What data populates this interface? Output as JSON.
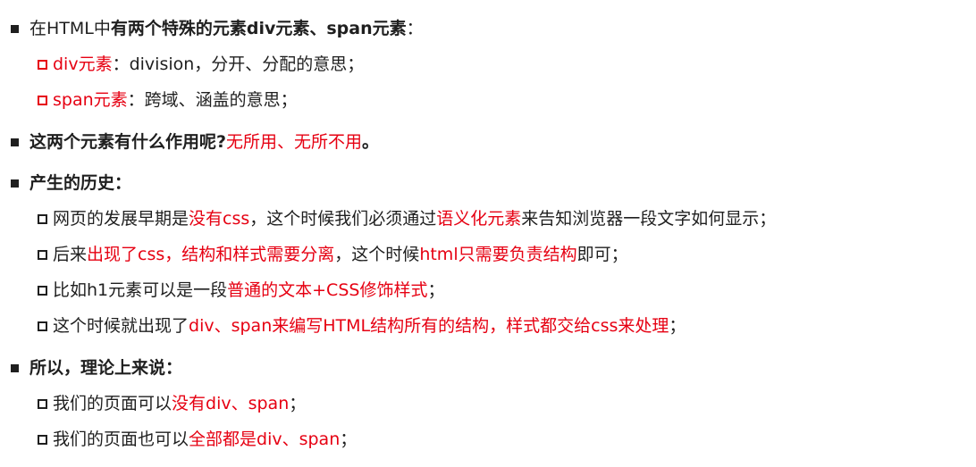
{
  "intro": {
    "pre": "在HTML中",
    "bold": "有两个特殊的元素div元素、span元素",
    "post": "："
  },
  "div_def": {
    "term": "div元素",
    "rest": "：division，分开、分配的意思；"
  },
  "span_def": {
    "term": "span元素",
    "rest": "：跨域、涵盖的意思；"
  },
  "q_role": {
    "question": "这两个元素有什么作用呢?",
    "answer": "无所用、无所不用",
    "end": "。"
  },
  "history": {
    "heading": "产生的历史：",
    "items": [
      {
        "a": "网页的发展早期是",
        "b": "没有css",
        "c": "，这个时候我们必须通过",
        "d": "语义化元素",
        "e": "来告知浏览器一段文字如何显示；"
      },
      {
        "a": "后来",
        "b": "出现了css",
        "c": "，",
        "d": "结构和样式需要分离",
        "e": "，这个时候",
        "f": "html只需要负责结构",
        "g": "即可；"
      },
      {
        "a": "比如h1元素可以是一段",
        "b": "普通的文本+CSS修饰样式",
        "c": "；"
      },
      {
        "a": "这个时候就出现了",
        "b": "div、span来编写HTML结构所有的结构",
        "c": "，",
        "d": "样式都交给css来处理",
        "e": "；"
      }
    ]
  },
  "conclusion": {
    "heading": "所以，理论上来说：",
    "items": [
      {
        "a": "我们的页面可以",
        "b": "没有div、span",
        "c": "；"
      },
      {
        "a": "我们的页面也可以",
        "b": "全部都是div、span",
        "c": "；"
      }
    ]
  },
  "colors": {
    "accent": "#e60012",
    "text": "#1f1f1f"
  },
  "icons": {
    "bullet": "filled-square-icon",
    "sub_bullet": "hollow-square-icon"
  }
}
